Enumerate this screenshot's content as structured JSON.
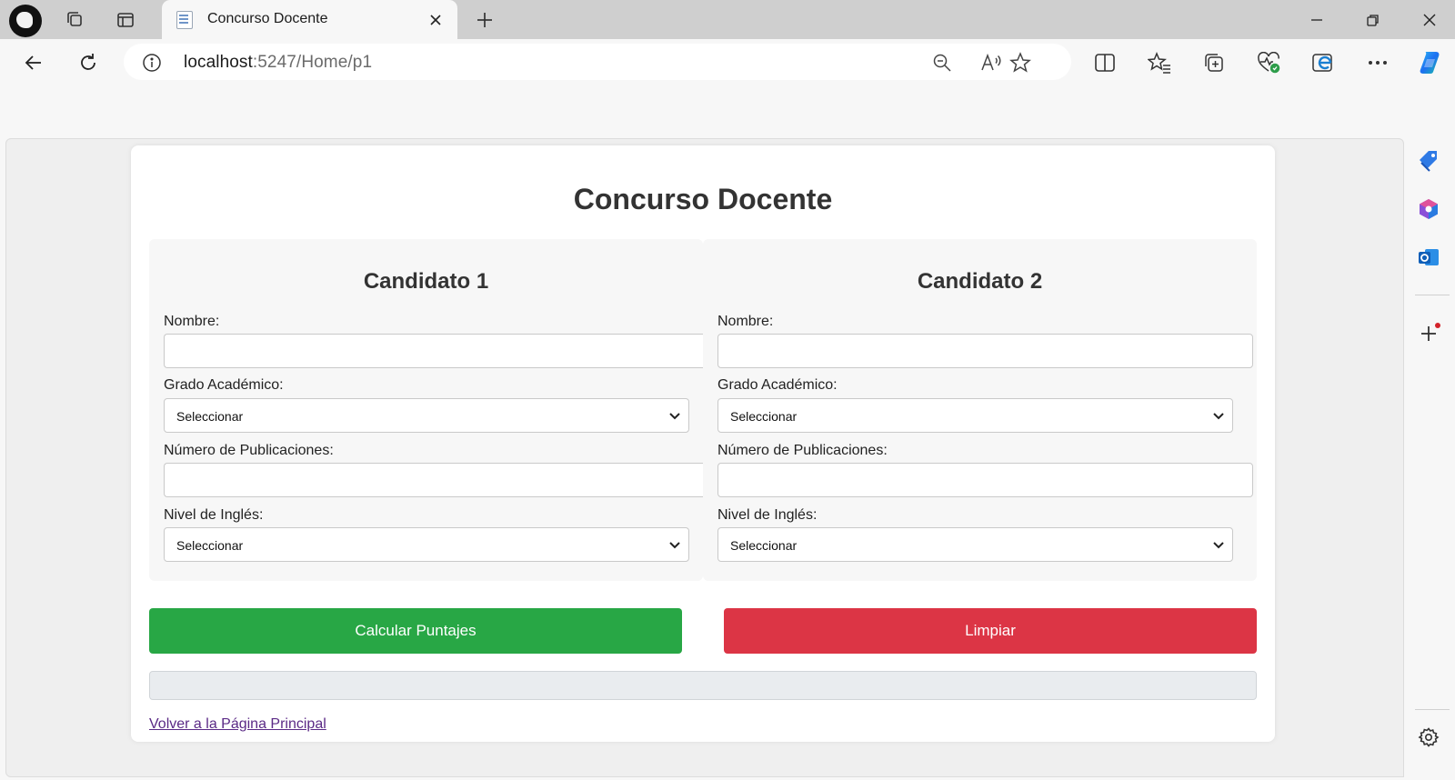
{
  "browser": {
    "tab": {
      "title": "Concurso Docente"
    },
    "address": {
      "host": "localhost",
      "path": ":5247/Home/p1"
    }
  },
  "page": {
    "title": "Concurso Docente",
    "candidates": [
      {
        "title": "Candidato 1",
        "nombre_label": "Nombre:",
        "nombre_value": "",
        "grado_label": "Grado Académico:",
        "grado_selected": "Seleccionar",
        "publicaciones_label": "Número de Publicaciones:",
        "publicaciones_value": "",
        "ingles_label": "Nivel de Inglés:",
        "ingles_selected": "Seleccionar"
      },
      {
        "title": "Candidato 2",
        "nombre_label": "Nombre:",
        "nombre_value": "",
        "grado_label": "Grado Académico:",
        "grado_selected": "Seleccionar",
        "publicaciones_label": "Número de Publicaciones:",
        "publicaciones_value": "",
        "ingles_label": "Nivel de Inglés:",
        "ingles_selected": "Seleccionar"
      }
    ],
    "buttons": {
      "calc_label": "Calcular Puntajes",
      "clear_label": "Limpiar"
    },
    "result_text": "",
    "back_link": "Volver a la Página Principal"
  },
  "colors": {
    "calc": "#28a745",
    "clear": "#dc3545",
    "link": "#5b2a86"
  },
  "icons": [
    "profile-avatar",
    "workspaces-icon",
    "tab-actions-icon",
    "page-icon",
    "close-icon",
    "plus-icon",
    "minimize-icon",
    "restore-icon",
    "back-icon",
    "refresh-icon",
    "info-icon",
    "zoom-out-icon",
    "read-aloud-icon",
    "star-icon",
    "split-screen-icon",
    "favorites-icon",
    "collections-icon",
    "browser-essentials-icon",
    "edge-icon",
    "more-icon",
    "copilot-icon",
    "tag-icon",
    "office-icon",
    "outlook-icon",
    "settings-icon"
  ]
}
